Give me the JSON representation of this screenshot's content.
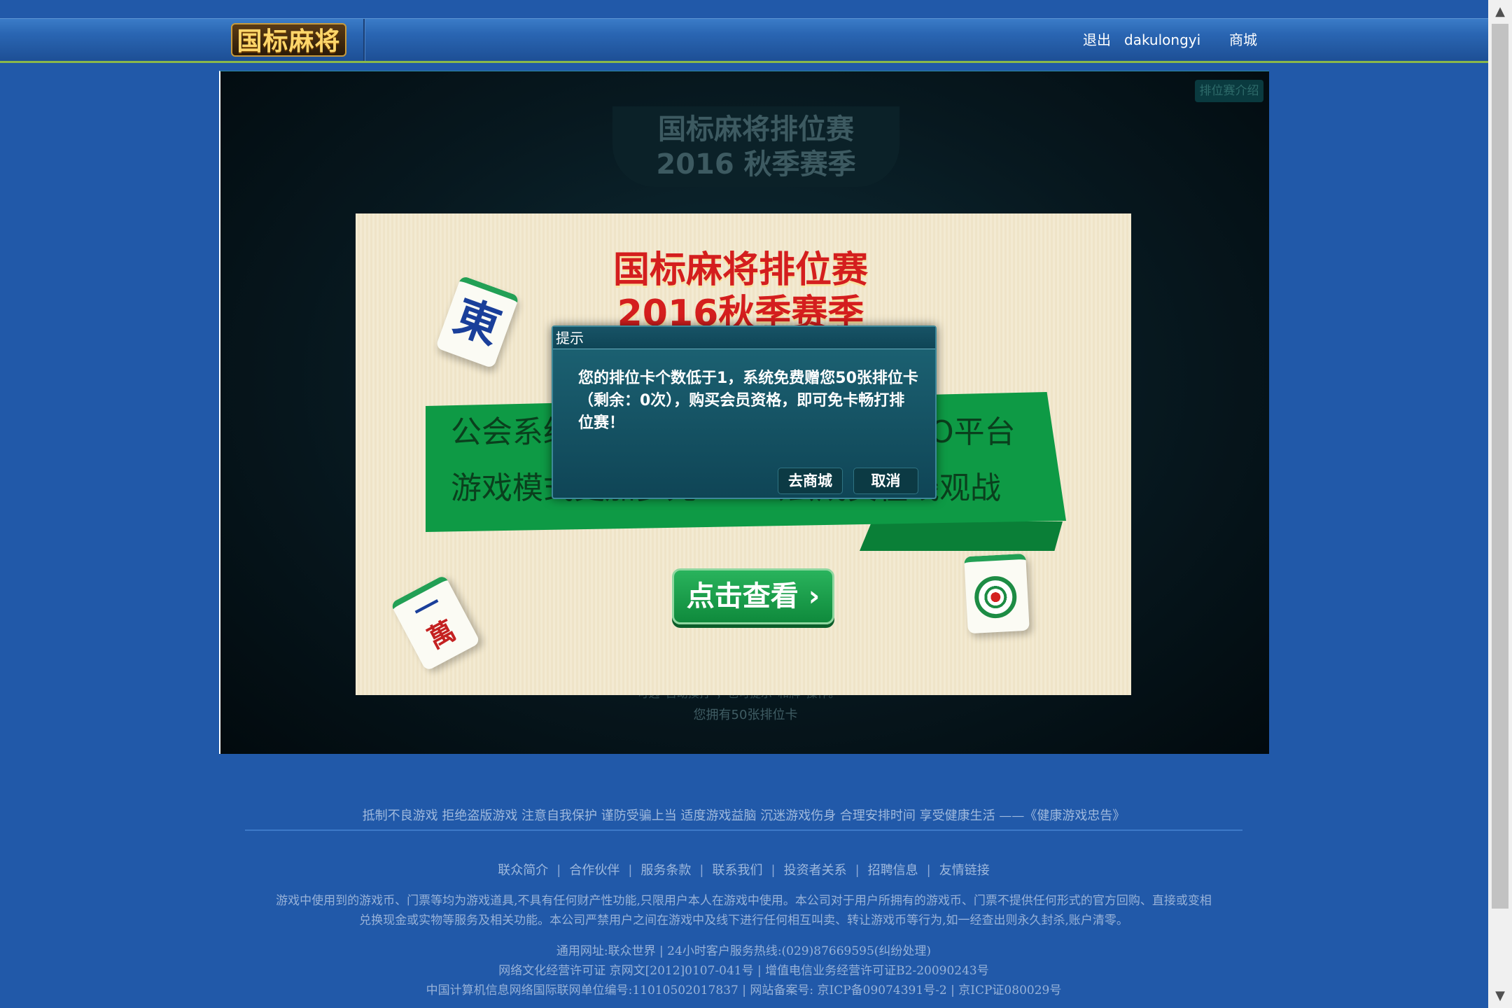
{
  "header": {
    "logo_text": "国标麻将",
    "logout_label": "退出",
    "username": "dakulongyi",
    "shop_label": "商城"
  },
  "game": {
    "intro_button": "排位赛介绍",
    "season_title_line1": "国标麻将排位赛",
    "season_title_line2": "2016 秋季赛季",
    "cards_owned": "您拥有50张排位卡",
    "faint_hint": "可选“自动摸打”，也可提示“和牌”操作。"
  },
  "banner": {
    "title_line1": "国标麻将排位赛",
    "title_line2": "2016秋季赛季",
    "ribbon_left_top": "公会系统",
    "ribbon_right_top": "O平台",
    "ribbon_left_bottom": "游戏模式更加多元",
    "ribbon_right_bottom": "公会成员在线观战",
    "view_button": "点击查看 ›",
    "tile_east": "東",
    "tile_wan_top": "一",
    "tile_wan_bottom": "萬"
  },
  "dialog": {
    "title": "提示",
    "message": "您的排位卡个数低于1，系统免费赠您50张排位卡（剩余：0次），购买会员资格，即可免卡畅打排位赛！",
    "go_shop_button": "去商城",
    "cancel_button": "取消"
  },
  "footer": {
    "slogan": "抵制不良游戏  拒绝盗版游戏  注意自我保护  谨防受骗上当  适度游戏益脑  沉迷游戏伤身  合理安排时间  享受健康生活  ——《健康游戏忠告》",
    "links": [
      "联众简介",
      "合作伙伴",
      "服务条款",
      "联系我们",
      "投资者关系",
      "招聘信息",
      "友情链接"
    ],
    "disclaimer_line1": "游戏中使用到的游戏币、门票等均为游戏道具,不具有任何财产性功能,只限用户本人在游戏中使用。本公司对于用户所拥有的游戏币、门票不提供任何形式的官方回购、直接或变相",
    "disclaimer_line2": "兑换现金或实物等服务及相关功能。本公司严禁用户之间在游戏中及线下进行任何相互叫卖、转让游戏币等行为,如一经查出则永久封杀,账户清零。",
    "contact_line": "通用网址:联众世界  |  24小时客户服务热线:(029)87669595(纠纷处理)",
    "license_line": "网络文化经营许可证    京网文[2012]0107-041号  |  增值电信业务经营许可证B2-20090243号",
    "icp_line": "中国计算机信息网络国际联网单位编号:11010502017837  |  网站备案号: 京ICP备09074391号-2  |  京ICP证080029号"
  }
}
